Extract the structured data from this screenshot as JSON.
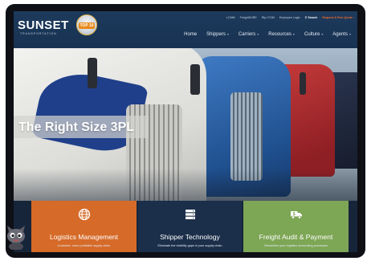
{
  "header": {
    "logo_text": "SUNSET",
    "logo_sub": "TRANSPORTATION",
    "badge_text": "TOP 10",
    "utility_links": [
      "LCMM",
      "FreightSURE",
      "Rip LTGM",
      "Employee Login"
    ],
    "search_label": "Search",
    "quote_label": "Request A Free Quote",
    "nav": [
      {
        "label": "Home",
        "has_caret": false
      },
      {
        "label": "Shippers",
        "has_caret": true
      },
      {
        "label": "Carriers",
        "has_caret": true
      },
      {
        "label": "Resources",
        "has_caret": true
      },
      {
        "label": "Culture",
        "has_caret": true
      },
      {
        "label": "Agents",
        "has_caret": true
      }
    ]
  },
  "hero": {
    "title": "The Right Size 3PL"
  },
  "cards": [
    {
      "title": "Logistics Management",
      "desc": "A smarter, more profitable supply chain",
      "icon": "globe-icon",
      "color": "#d66a28"
    },
    {
      "title": "Shipper Technology",
      "desc": "Eliminate the visibility gaps in your supply chain",
      "icon": "server-icon",
      "color": "#1b2f4a"
    },
    {
      "title": "Freight Audit & Payment",
      "desc": "Streamline your logistics accounting processes",
      "icon": "truck-money-icon",
      "color": "#7da655"
    }
  ],
  "colors": {
    "header_bg": "#1d3a5c",
    "accent_orange": "#f26b2b"
  }
}
